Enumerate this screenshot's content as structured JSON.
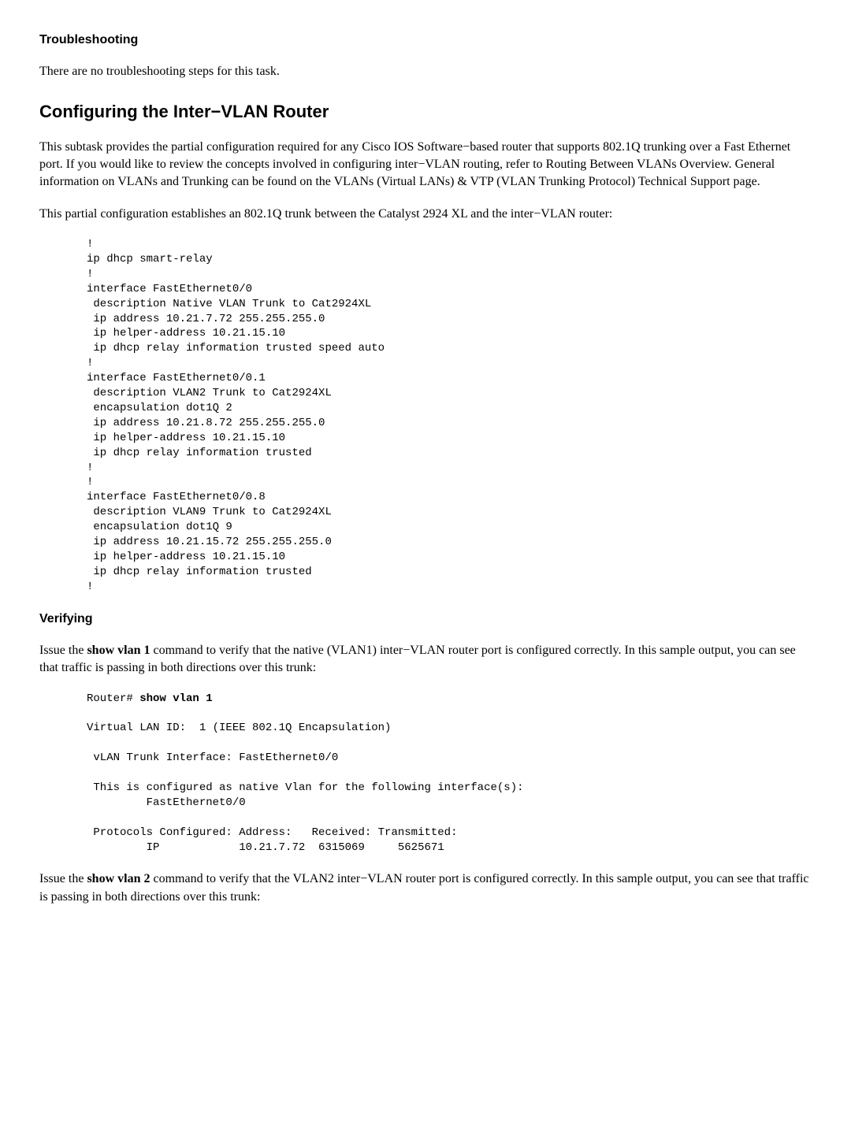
{
  "headings": {
    "troubleshooting": "Troubleshooting",
    "configuring": "Configuring the Inter−VLAN Router",
    "verifying": "Verifying"
  },
  "paragraphs": {
    "no_troubleshooting": "There are no troubleshooting steps for this task.",
    "subtask_intro": "This subtask provides the partial configuration required for any Cisco IOS Software−based router that supports 802.1Q trunking over a Fast Ethernet port. If you would like to review the concepts involved in configuring inter−VLAN routing, refer to Routing Between VLANs Overview. General information on VLANs and Trunking can be found on the VLANs (Virtual LANs) & VTP (VLAN Trunking Protocol) Technical Support page.",
    "partial_config": "This partial configuration establishes an 802.1Q trunk between the Catalyst 2924 XL and the inter−VLAN router:",
    "verify_vlan1_a": "Issue the ",
    "verify_vlan1_cmd": "show vlan 1",
    "verify_vlan1_b": " command to verify that the native (VLAN1) inter−VLAN router port is configured correctly. In this sample output, you can see that traffic is passing in both directions over this trunk:",
    "verify_vlan2_a": "Issue the ",
    "verify_vlan2_cmd": "show vlan 2",
    "verify_vlan2_b": " command to verify that the VLAN2 inter−VLAN router port is configured correctly. In this sample output, you can see that traffic is passing in both directions over this trunk:"
  },
  "code": {
    "router_config": "!\nip dhcp smart-relay\n!\ninterface FastEthernet0/0\n description Native VLAN Trunk to Cat2924XL\n ip address 10.21.7.72 255.255.255.0\n ip helper-address 10.21.15.10\n ip dhcp relay information trusted speed auto\n!\ninterface FastEthernet0/0.1\n description VLAN2 Trunk to Cat2924XL\n encapsulation dot1Q 2\n ip address 10.21.8.72 255.255.255.0\n ip helper-address 10.21.15.10\n ip dhcp relay information trusted\n!\n!\ninterface FastEthernet0/0.8\n description VLAN9 Trunk to Cat2924XL\n encapsulation dot1Q 9\n ip address 10.21.15.72 255.255.255.0\n ip helper-address 10.21.15.10\n ip dhcp relay information trusted\n!",
    "show_vlan1_prompt": "Router# ",
    "show_vlan1_cmd": "show vlan 1",
    "show_vlan1_output": "\n\nVirtual LAN ID:  1 (IEEE 802.1Q Encapsulation)\n\n vLAN Trunk Interface: FastEthernet0/0\n\n This is configured as native Vlan for the following interface(s):\n         FastEthernet0/0\n\n Protocols Configured: Address:   Received: Transmitted:\n         IP            10.21.7.72  6315069     5625671"
  }
}
